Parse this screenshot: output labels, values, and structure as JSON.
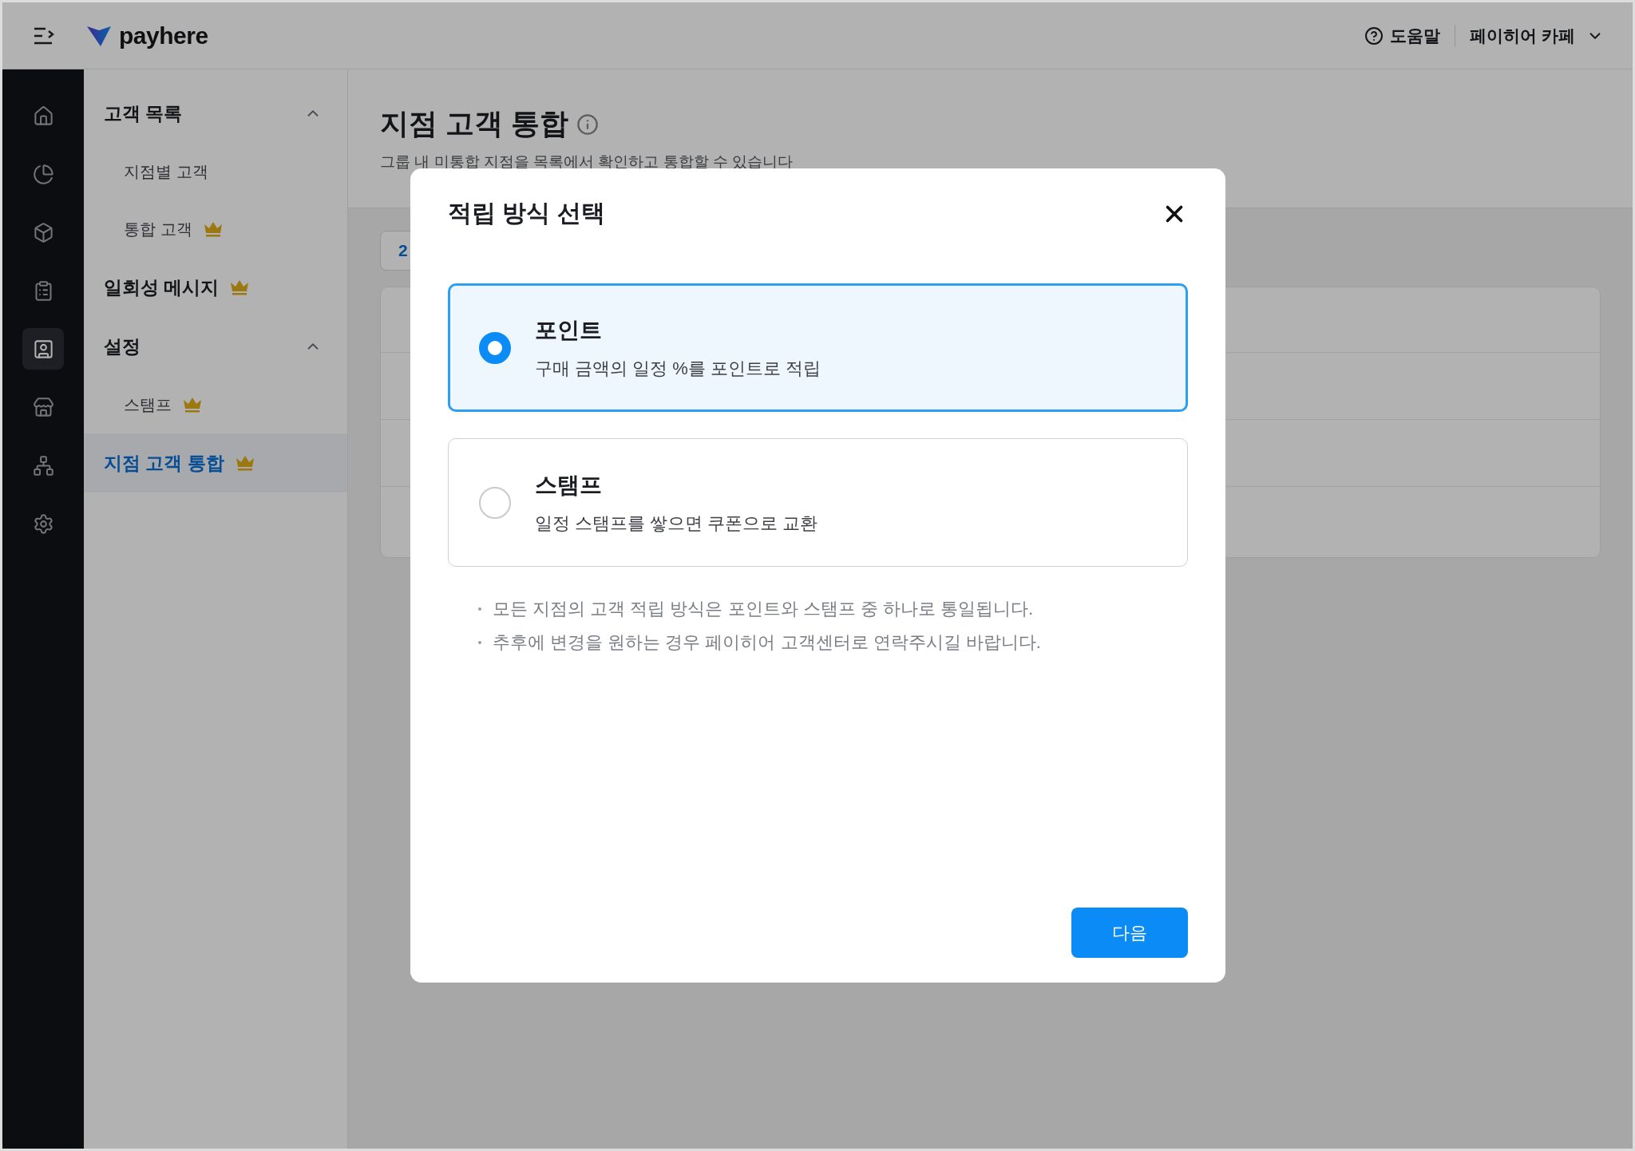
{
  "topbar": {
    "logo": "payhere",
    "help": "도움말",
    "store": "페이히어 카페"
  },
  "rail": [
    {
      "selected": false
    },
    {
      "selected": false
    },
    {
      "selected": false
    },
    {
      "selected": false
    },
    {
      "selected": true
    },
    {
      "selected": false
    },
    {
      "selected": false
    },
    {
      "selected": false
    }
  ],
  "sidebar": {
    "items": [
      {
        "kind": "group",
        "label": "고객 목록",
        "expanded": true,
        "selected": false,
        "children": [
          {
            "label": "지점별 고객",
            "selected": false
          },
          {
            "label": "통합 고객",
            "premium": true,
            "selected": false
          }
        ]
      },
      {
        "kind": "link",
        "label": "일회성 메시지",
        "premium": true,
        "selected": false
      },
      {
        "kind": "group",
        "label": "설정",
        "expanded": true,
        "selected": false,
        "children": [
          {
            "label": "스탬프",
            "premium": true,
            "selected": false
          }
        ]
      },
      {
        "kind": "link",
        "label": "지점 고객 통합",
        "premium": true,
        "selected": true
      }
    ]
  },
  "page": {
    "title": "지점 고객 통합",
    "subtitle": "그룹 내 미통합 지점을 목록에서 확인하고 통합할 수 있습니다",
    "chip": "2"
  },
  "modal": {
    "title": "적립 방식 선택",
    "options": [
      {
        "title": "포인트",
        "description": "구매 금액의 일정 %를 포인트로 적립",
        "selected": true
      },
      {
        "title": "스탬프",
        "description": "일정 스탬프를 쌓으면 쿠폰으로 교환",
        "selected": false
      }
    ],
    "notes": [
      "모든 지점의 고객 적립 방식은 포인트와 스탬프 중 하나로 통일됩니다.",
      "추후에 변경을 원하는 경우 페이히어 고객센터로 연락주시길 바랍니다."
    ],
    "button": "다음"
  }
}
